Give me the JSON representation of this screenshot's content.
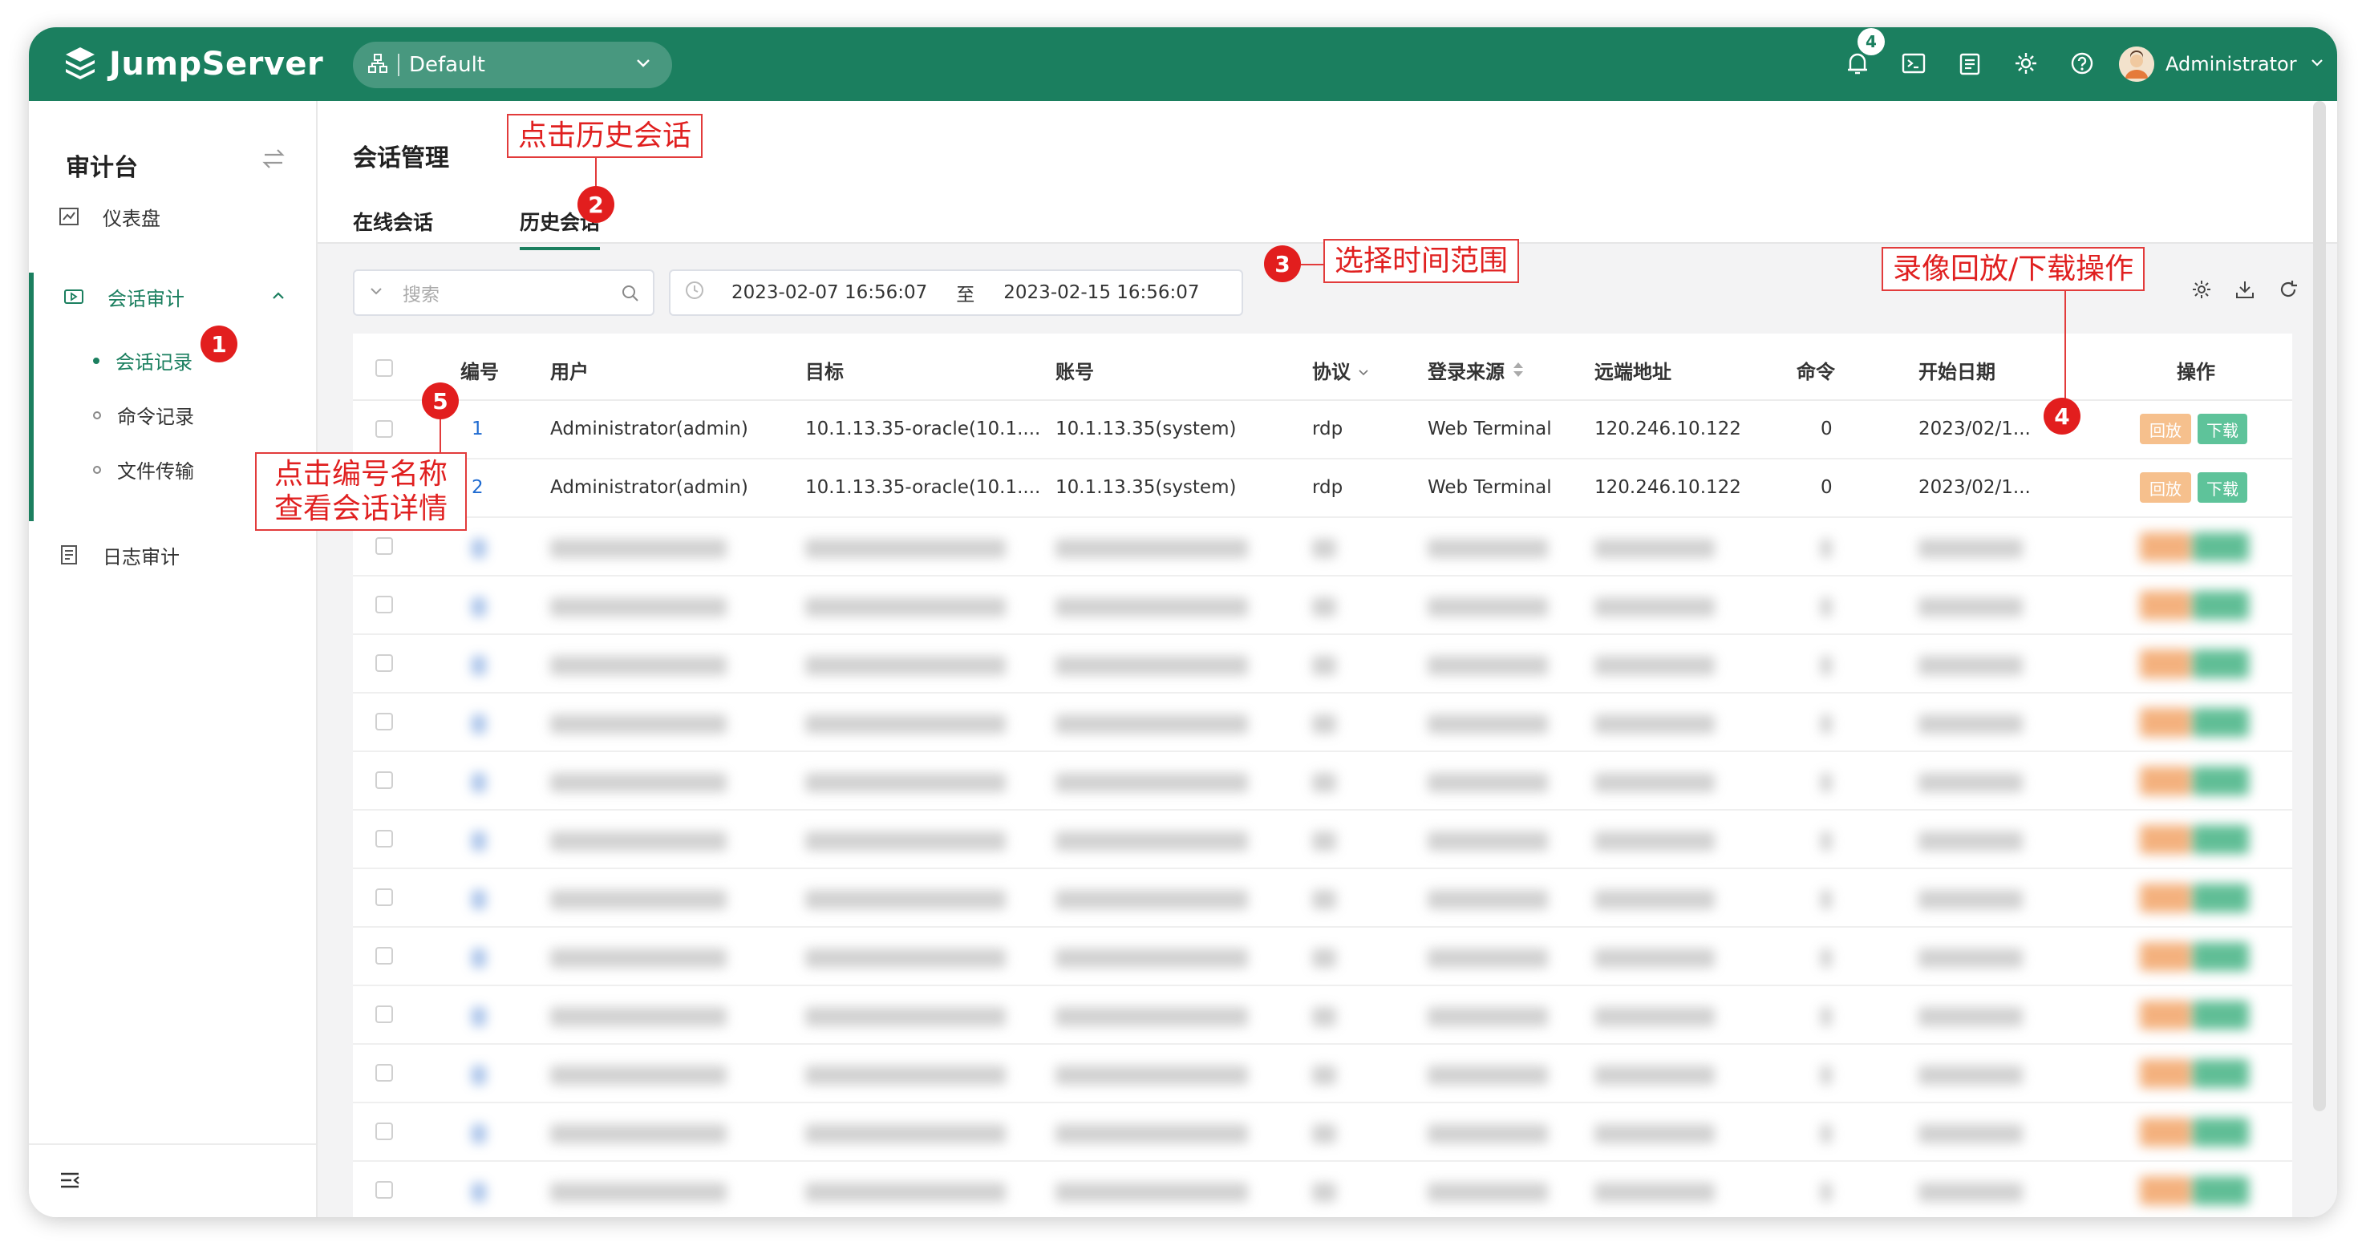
{
  "app": {
    "brand": "JumpServer",
    "org": "Default",
    "notif_count": "4",
    "user": "Administrator"
  },
  "colors": {
    "primary": "#1b7f5f",
    "link": "#1f6bd1",
    "replay": "#f6c08d",
    "download": "#5ec39a",
    "annotation": "#e02020"
  },
  "sidebar": {
    "title": "审计台",
    "dashboard": "仪表盘",
    "session_audit": "会话审计",
    "sub": [
      "会话记录",
      "命令记录",
      "文件传输"
    ],
    "log_audit": "日志审计"
  },
  "page": {
    "title": "会话管理",
    "tabs": [
      "在线会话",
      "历史会话"
    ],
    "search_placeholder": "搜索",
    "date_from": "2023-02-07 16:56:07",
    "date_sep": "至",
    "date_to": "2023-02-15 16:56:07"
  },
  "table": {
    "headers": [
      "编号",
      "用户",
      "目标",
      "账号",
      "协议",
      "登录来源",
      "远端地址",
      "命令",
      "开始日期",
      "操作"
    ],
    "rows": [
      {
        "id": "1",
        "user": "Administrator(admin)",
        "target": "10.1.13.35-oracle(10.1....",
        "account": "10.1.13.35(system)",
        "protocol": "rdp",
        "source": "Web Terminal",
        "remote": "120.246.10.122",
        "cmd": "0",
        "date": "2023/02/1...",
        "replay": "回放",
        "download": "下载"
      },
      {
        "id": "2",
        "user": "Administrator(admin)",
        "target": "10.1.13.35-oracle(10.1....",
        "account": "10.1.13.35(system)",
        "protocol": "rdp",
        "source": "Web Terminal",
        "remote": "120.246.10.122",
        "cmd": "0",
        "date": "2023/02/1...",
        "replay": "回放",
        "download": "下载"
      }
    ]
  },
  "annotations": {
    "a1": "1",
    "a2": "2",
    "a2_text": "点击历史会话",
    "a3": "3",
    "a3_text": "选择时间范围",
    "a4": "4",
    "a4_text": "录像回放/下载操作",
    "a5": "5",
    "a5_text_line1": "点击编号名称",
    "a5_text_line2": "查看会话详情"
  },
  "icons": [
    "logo-icon",
    "org-icon",
    "chevron-down-icon",
    "bell-icon",
    "terminal-icon",
    "clipboard-icon",
    "gear-icon",
    "help-icon",
    "swap-icon",
    "chart-icon",
    "video-icon",
    "log-icon",
    "collapse-icon",
    "search-icon",
    "clock-icon",
    "settings-icon",
    "download-icon",
    "refresh-icon",
    "sort-icon"
  ]
}
